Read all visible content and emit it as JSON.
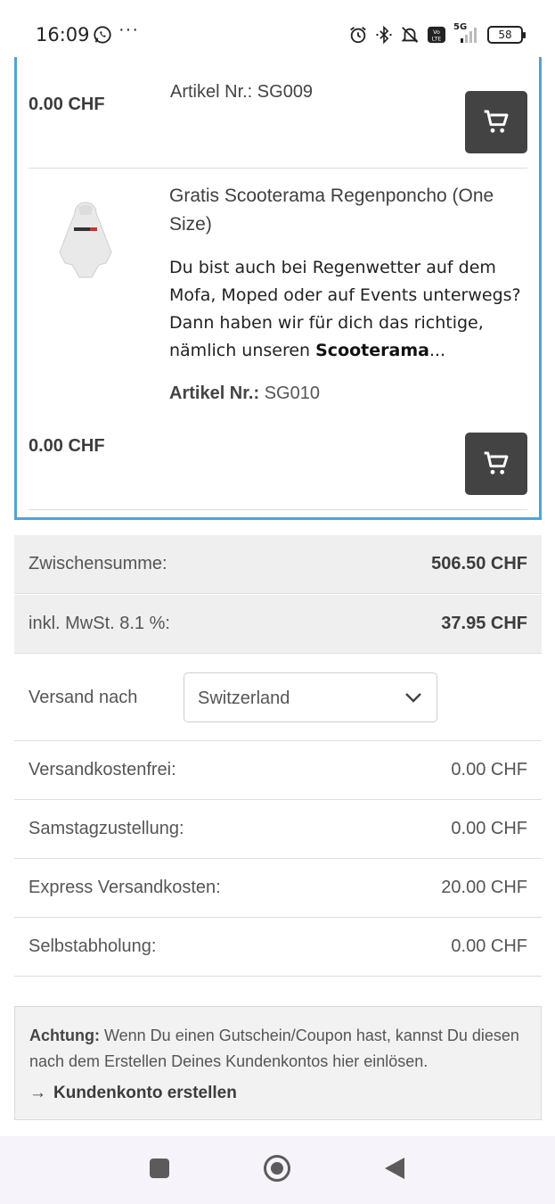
{
  "status_bar": {
    "time": "16:09",
    "notif_overflow": "···",
    "network": "5G",
    "battery": "58"
  },
  "products": [
    {
      "title_clipped": "Artikel Nr.: SG009",
      "price": "0.00 CHF"
    },
    {
      "title": "Gratis Scooterama Regenponcho (One Size)",
      "desc_line1": "Du bist auch bei Regenwetter auf dem Mofa, Moped oder auf Events unterwegs?",
      "desc_line2": "Dann haben wir für dich das richtige, nämlich unseren ",
      "desc_bold": "Scooterama",
      "desc_ellipsis": "...",
      "artikel_label": "Artikel Nr.:",
      "artikel_value": "SG010",
      "price": "0.00 CHF"
    }
  ],
  "totals": {
    "subtotal_label": "Zwischensumme:",
    "subtotal_value": "506.50 CHF",
    "vat_label": "inkl. MwSt. 8.1 %:",
    "vat_value": "37.95 CHF"
  },
  "shipping": {
    "label": "Versand nach",
    "selected_country": "Switzerland",
    "options": [
      {
        "label": "Versandkostenfrei:",
        "value": "0.00 CHF"
      },
      {
        "label": "Samstagzustellung:",
        "value": "0.00 CHF"
      },
      {
        "label": "Express Versandkosten:",
        "value": "20.00 CHF"
      },
      {
        "label": "Selbstabholung:",
        "value": "0.00 CHF"
      }
    ]
  },
  "notice": {
    "bold": "Achtung:",
    "text": " Wenn Du einen Gutschein/Coupon hast, kannst Du diesen nach dem Erstellen Deines Kundenkontos hier einlösen.",
    "link_arrow": "→",
    "link_label": "Kundenkonto erstellen"
  },
  "icons": {
    "cart": "cart-icon",
    "whatsapp": "whatsapp-icon",
    "alarm": "alarm-icon",
    "bluetooth": "bluetooth-icon",
    "mute": "bell-off-icon",
    "volte": "volte-icon",
    "signal": "signal-icon",
    "chevron": "chevron-down-icon"
  },
  "colors": {
    "accent_border": "#4fa3d9",
    "cart_button": "#434343",
    "grey_row": "#efefef"
  }
}
